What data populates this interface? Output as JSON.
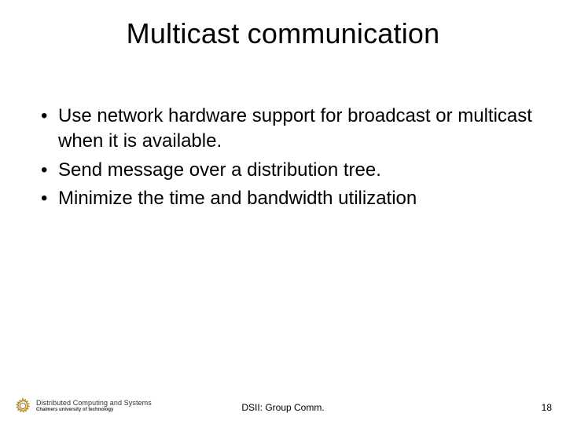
{
  "title": "Multicast communication",
  "bullets": [
    "Use network hardware support for broadcast or multicast when it is available.",
    "Send message over a distribution tree.",
    "Minimize the time and bandwidth utilization"
  ],
  "footer": {
    "center": "DSII: Group Comm.",
    "page": "18",
    "logo": {
      "line1": "Distributed Computing and Systems",
      "line2": "Chalmers university of technology"
    }
  }
}
